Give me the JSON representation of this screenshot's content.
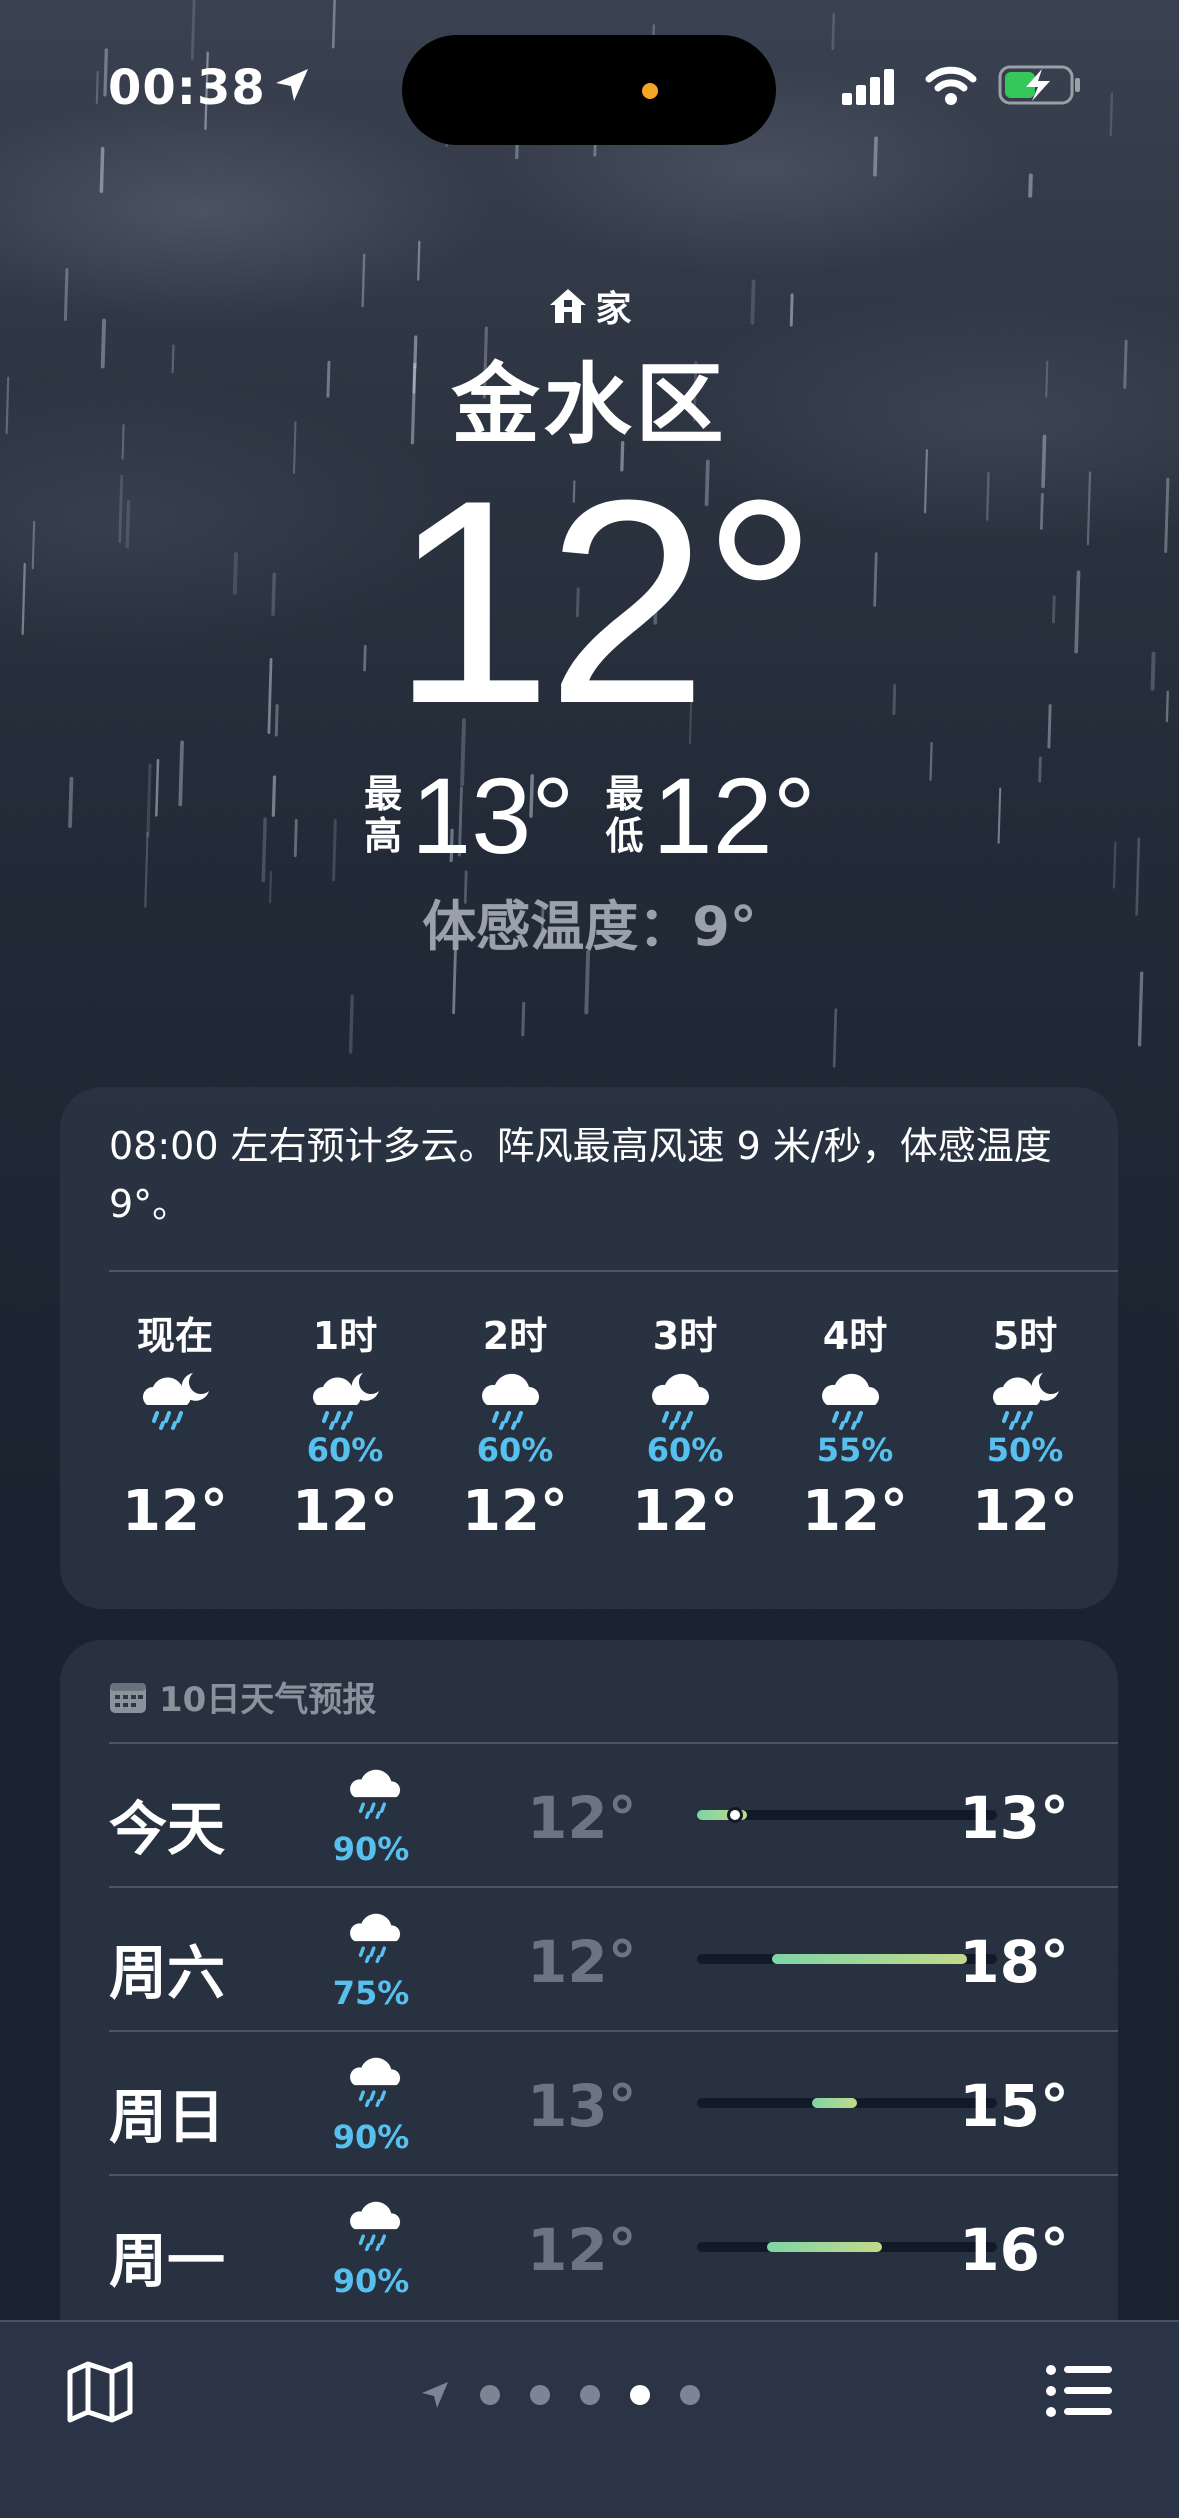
{
  "status_bar": {
    "time": "00:38"
  },
  "header": {
    "home_label": "家",
    "location": "金水区",
    "current_temp": "12°",
    "high_label_1": "最",
    "high_label_2": "高",
    "high_temp": "13°",
    "low_label_1": "最",
    "low_label_2": "低",
    "low_temp": "12°",
    "feels_like": "体感温度：9°"
  },
  "hourly": {
    "summary": "08:00 左右预计多云。阵风最高风速 9 米/秒，体感温度 9°。",
    "items": [
      {
        "label": "现在",
        "icon": "cloud-moon-rain",
        "pct": "",
        "temp": "12°"
      },
      {
        "label": "1时",
        "icon": "cloud-moon-rain",
        "pct": "60%",
        "temp": "12°"
      },
      {
        "label": "2时",
        "icon": "cloud-rain",
        "pct": "60%",
        "temp": "12°"
      },
      {
        "label": "3时",
        "icon": "cloud-rain",
        "pct": "60%",
        "temp": "12°"
      },
      {
        "label": "4时",
        "icon": "cloud-rain",
        "pct": "55%",
        "temp": "12°"
      },
      {
        "label": "5时",
        "icon": "cloud-moon-rain",
        "pct": "50%",
        "temp": "12°"
      }
    ]
  },
  "daily": {
    "title": "10日天气预报",
    "range_min": 12,
    "range_max": 18,
    "rows": [
      {
        "day": "今天",
        "icon": "cloud-rain",
        "pct": "90%",
        "low": "12°",
        "high": "13°",
        "lo": 12,
        "hi": 13,
        "now": 12
      },
      {
        "day": "周六",
        "icon": "cloud-rain",
        "pct": "75%",
        "low": "12°",
        "high": "18°",
        "lo": 13.5,
        "hi": 17.4
      },
      {
        "day": "周日",
        "icon": "cloud-rain",
        "pct": "90%",
        "low": "13°",
        "high": "15°",
        "lo": 14.3,
        "hi": 15.2
      },
      {
        "day": "周一",
        "icon": "cloud-rain",
        "pct": "90%",
        "low": "12°",
        "high": "16°",
        "lo": 13.4,
        "hi": 15.7
      }
    ]
  },
  "bottom_bar": {
    "page_count": 6,
    "active_page": 4
  },
  "colors": {
    "accent_blue": "#58c0ee",
    "battery_green": "#35c759",
    "island_dot": "#f5a623"
  }
}
